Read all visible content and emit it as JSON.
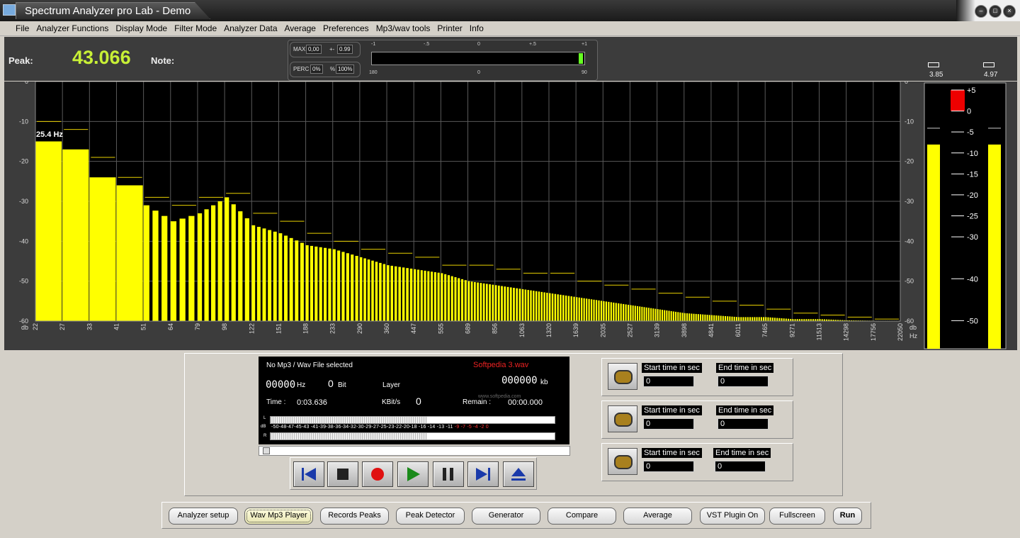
{
  "window": {
    "title": "Spectrum Analyzer pro Lab - Demo"
  },
  "menu": [
    "File",
    "Analyzer Functions",
    "Display Mode",
    "Filter Mode",
    "Analyzer Data",
    "Average",
    "Preferences",
    "Mp3/wav tools",
    "Printer",
    "Info"
  ],
  "header": {
    "peak_label": "Peak:",
    "peak_value": "43.066",
    "note_label": "Note:",
    "max_label": "MAX",
    "max_value": "0,00",
    "pm_label": "+-",
    "pm_value": "0.99",
    "perc_label": "PERC",
    "perc_value": "0%",
    "perc_unit": "%",
    "perc_value2": "100%",
    "scale_top": [
      "-1",
      "-.5",
      "0",
      "+.5",
      "+1"
    ],
    "scale_bottom": [
      "180",
      "0",
      "90"
    ],
    "vu_left_value": "3.85",
    "vu_right_value": "4.97"
  },
  "spectrum": {
    "freq_readout": "25.4 Hz",
    "y_unit": "db",
    "x_unit": "Hz",
    "y_ticks": [
      "0",
      "-10",
      "-20",
      "-30",
      "-40",
      "-50",
      "-60"
    ],
    "x_ticks": [
      "22",
      "27",
      "33",
      "41",
      "51",
      "64",
      "79",
      "98",
      "122",
      "151",
      "188",
      "233",
      "290",
      "360",
      "447",
      "555",
      "689",
      "856",
      "1063",
      "1320",
      "1639",
      "2035",
      "2527",
      "3139",
      "3898",
      "4841",
      "6011",
      "7465",
      "9271",
      "11513",
      "14298",
      "17756",
      "22050"
    ],
    "vu_scale": [
      "+5",
      "0",
      "-5",
      "-10",
      "-15",
      "-20",
      "-25",
      "-30",
      "-40",
      "-50"
    ],
    "vu_left_level": -8,
    "vu_right_level": -8
  },
  "chart_data": {
    "type": "bar",
    "title": "",
    "xlabel": "Hz",
    "ylabel": "db",
    "ylim": [
      -60,
      0
    ],
    "x_scale": "log",
    "categories": [
      "22",
      "27",
      "33",
      "41",
      "51",
      "64",
      "79",
      "98",
      "122",
      "151",
      "188",
      "233",
      "290",
      "360",
      "447",
      "555",
      "689",
      "856",
      "1063",
      "1320",
      "1639",
      "2035",
      "2527",
      "3139",
      "3898",
      "4841",
      "6011",
      "7465",
      "9271",
      "11513",
      "14298",
      "17756"
    ],
    "values": [
      -15,
      -17,
      -24,
      -26,
      -31,
      -35,
      -33,
      -29,
      -36,
      -38,
      -41,
      -42,
      -44,
      -46,
      -47,
      -48,
      -50,
      -51,
      -52,
      -53,
      -54,
      -55,
      -56,
      -57,
      -58,
      -58.5,
      -59,
      -59,
      -59.5,
      -59.5,
      -59.8,
      -59.9
    ],
    "peak_values": [
      -10,
      -12,
      -19,
      -24,
      -29,
      -31,
      -29,
      -28,
      -33,
      -35,
      -38,
      -40,
      -42,
      -43,
      -44,
      -46,
      -46,
      -47,
      -48,
      -48,
      -50,
      -51,
      -52,
      -53,
      -54,
      -55,
      -56,
      -57,
      -58,
      -58.5,
      -59,
      -59.5
    ]
  },
  "player": {
    "file_status": "No Mp3 / Wav File selected",
    "file_name": "Softpedia 3.wav",
    "hz_value": "00000",
    "hz_unit": "Hz",
    "bit_value": "0",
    "bit_unit": "Bit",
    "layer_label": "Layer",
    "kb_value": "000000",
    "kb_unit": "kb",
    "time_label": "Time :",
    "time_value": "0:03.636",
    "kbits_label": "KBit/s",
    "kbits_value": "0",
    "remain_label": "Remain :",
    "remain_value": "00:00.000",
    "left_channel": "L",
    "right_channel": "R",
    "db_label": "dB",
    "db_scale": "-50-48-47-45-43 -41-39-38-36-34-32-30-29-27-25-23-22-20-18 -16 -14 -13 -11",
    "db_scale_hot": "-9  -7  -5  -4  -2   0",
    "watermark": "www.softpedia.com"
  },
  "loops": [
    {
      "start_label": "Start time in sec",
      "end_label": "End time in sec",
      "start_value": "0",
      "end_value": "0"
    },
    {
      "start_label": "Start time in sec",
      "end_label": "End time in sec",
      "start_value": "0",
      "end_value": "0"
    },
    {
      "start_label": "Start time in sec",
      "end_label": "End time in sec",
      "start_value": "0",
      "end_value": "0"
    }
  ],
  "toolbar": [
    "Analyzer setup",
    "Wav Mp3 Player",
    "Records Peaks",
    "Peak Detector",
    "Generator",
    "Compare",
    "Average",
    "VST Plugin On",
    "Fullscreen",
    "Run"
  ],
  "colors": {
    "bar": "#ffff00",
    "peak_line": "#e8d000",
    "background": "#000000",
    "digits": "#c8f036"
  }
}
